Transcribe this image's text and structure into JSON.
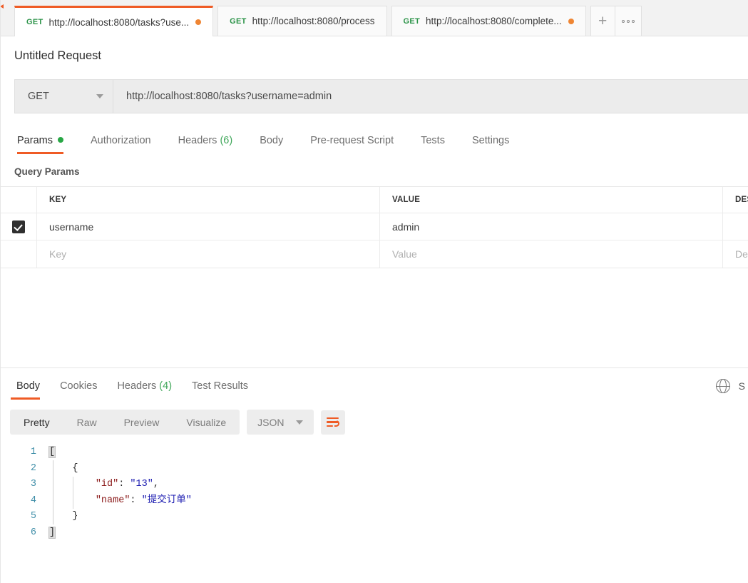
{
  "tabbar": {
    "tabs": [
      {
        "method": "GET",
        "url": "http://localhost:8080/tasks?use...",
        "unsaved": true,
        "active": true
      },
      {
        "method": "GET",
        "url": "http://localhost:8080/process",
        "unsaved": false,
        "active": false
      },
      {
        "method": "GET",
        "url": "http://localhost:8080/complete...",
        "unsaved": true,
        "active": false
      }
    ],
    "new_tab_label": "+",
    "more_label": "•••"
  },
  "request": {
    "title": "Untitled Request",
    "method": "GET",
    "url": "http://localhost:8080/tasks?username=admin",
    "tabs": [
      {
        "label": "Params",
        "count": "",
        "dot": true,
        "active": true
      },
      {
        "label": "Authorization",
        "count": "",
        "dot": false,
        "active": false
      },
      {
        "label": "Headers",
        "count": "(6)",
        "dot": false,
        "active": false
      },
      {
        "label": "Body",
        "count": "",
        "dot": false,
        "active": false
      },
      {
        "label": "Pre-request Script",
        "count": "",
        "dot": false,
        "active": false
      },
      {
        "label": "Tests",
        "count": "",
        "dot": false,
        "active": false
      },
      {
        "label": "Settings",
        "count": "",
        "dot": false,
        "active": false
      }
    ],
    "query_params": {
      "section_label": "Query Params",
      "columns": {
        "key": "KEY",
        "value": "VALUE",
        "description": "DESCRIPTION"
      },
      "rows": [
        {
          "checked": true,
          "key": "username",
          "value": "admin",
          "description": ""
        }
      ],
      "placeholder_row": {
        "key": "Key",
        "value": "Value",
        "description": "Description"
      }
    }
  },
  "response": {
    "tabs": [
      {
        "label": "Body",
        "count": "",
        "active": true
      },
      {
        "label": "Cookies",
        "count": "",
        "active": false
      },
      {
        "label": "Headers",
        "count": "(4)",
        "active": false
      },
      {
        "label": "Test Results",
        "count": "",
        "active": false
      }
    ],
    "globe_icon": "globe-icon",
    "save_response_label": "S",
    "body_toolbar": {
      "views": [
        {
          "label": "Pretty",
          "active": true
        },
        {
          "label": "Raw",
          "active": false
        },
        {
          "label": "Preview",
          "active": false
        },
        {
          "label": "Visualize",
          "active": false
        }
      ],
      "format": "JSON",
      "wrap_icon": "wrap-text-icon"
    },
    "body": {
      "language": "json",
      "line_numbers": [
        "1",
        "2",
        "3",
        "4",
        "5",
        "6"
      ],
      "lines": [
        {
          "n": "1",
          "text": "["
        },
        {
          "n": "2",
          "text": "    {"
        },
        {
          "n": "3",
          "key": "\"id\"",
          "value": "\"13\"",
          "text": "        \"id\": \"13\","
        },
        {
          "n": "4",
          "key": "\"name\"",
          "value": "\"提交订单\"",
          "text": "        \"name\": \"提交订单\""
        },
        {
          "n": "5",
          "text": "    }"
        },
        {
          "n": "6",
          "text": "]"
        }
      ],
      "raw": "[\n    {\n        \"id\": \"13\",\n        \"name\": \"提交订单\"\n    }\n]"
    }
  },
  "colors": {
    "accent": "#ef5b25",
    "method_green": "#2b9348",
    "unsaved_dot": "#ef8533",
    "status_green": "#28a745",
    "json_key": "#8b1a1a",
    "json_string": "#1a1ab0",
    "gutter": "#3f8ea8"
  }
}
